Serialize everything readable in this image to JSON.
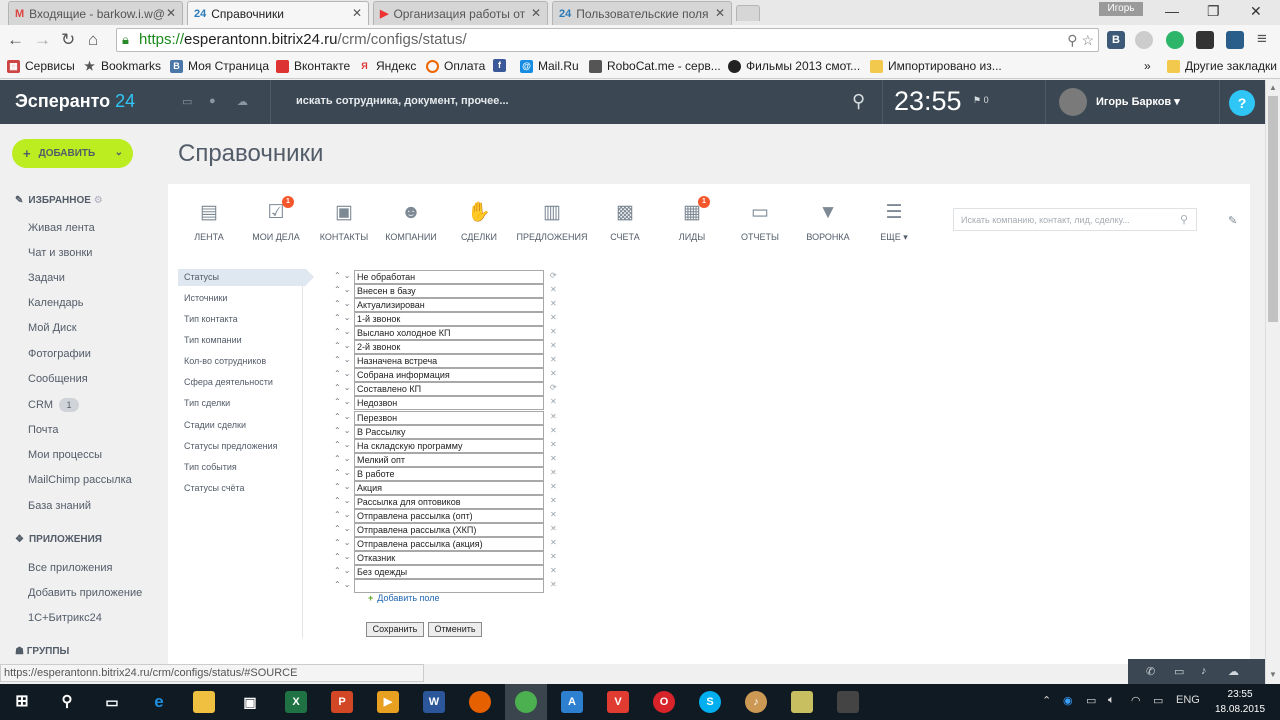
{
  "browser": {
    "tabs": [
      {
        "title": "Входящие - barkow.i.w@",
        "icon": "gmail-icon"
      },
      {
        "title": "Справочники",
        "icon": "bitrix24-icon"
      },
      {
        "title": "Организация работы от",
        "icon": "youtube-icon"
      },
      {
        "title": "Пользовательские поля",
        "icon": "bitrix24-icon"
      }
    ],
    "window_user": "Игорь",
    "url_protocol": "https://",
    "url_host": "esperantonn.bitrix24.ru",
    "url_path": "/crm/configs/status/",
    "bookmarks": [
      "Сервисы",
      "Bookmarks",
      "Моя Страница",
      "Вконтакте",
      "Яндекс",
      "Оплата",
      "Mail.Ru",
      "RoboCat.me - серв...",
      "Фильмы 2013 смот...",
      "Импортировано из..."
    ],
    "bookmarks_more": "»",
    "other_bookmarks": "Другие закладки"
  },
  "header": {
    "logo_main": "Эсперанто",
    "logo_num": "24",
    "search_placeholder": "искать сотрудника, документ, прочее...",
    "time": "23:55",
    "flag_count": "0",
    "user_name": "Игорь Барков",
    "help": "?"
  },
  "sidebar": {
    "add_button": "ДОБАВИТЬ",
    "favorites_title": "ИЗБРАННОЕ",
    "favorites": [
      "Живая лента",
      "Чат и звонки",
      "Задачи",
      "Календарь",
      "Мой Диск",
      "Фотографии",
      "Сообщения",
      "CRM",
      "Почта",
      "Мои процессы",
      "MailChimp рассылка",
      "База знаний"
    ],
    "crm_badge": "1",
    "apps_title": "ПРИЛОЖЕНИЯ",
    "apps": [
      "Все приложения",
      "Добавить приложение",
      "1С+Битрикс24"
    ],
    "groups_title": "ГРУППЫ"
  },
  "page": {
    "title": "Справочники",
    "toolbar": [
      {
        "label": "ЛЕНТА",
        "icon": "feed-icon"
      },
      {
        "label": "МОИ ДЕЛА",
        "icon": "tasks-icon",
        "count": "1"
      },
      {
        "label": "КОНТАКТЫ",
        "icon": "contacts-icon"
      },
      {
        "label": "КОМПАНИИ",
        "icon": "companies-icon"
      },
      {
        "label": "СДЕЛКИ",
        "icon": "deals-icon"
      },
      {
        "label": "ПРЕДЛОЖЕНИЯ",
        "icon": "quotes-icon"
      },
      {
        "label": "СЧЕТА",
        "icon": "invoices-icon"
      },
      {
        "label": "ЛИДЫ",
        "icon": "leads-icon",
        "count": "1"
      },
      {
        "label": "ОТЧЕТЫ",
        "icon": "reports-icon"
      },
      {
        "label": "ВОРОНКА",
        "icon": "funnel-icon"
      },
      {
        "label": "ЕЩЕ",
        "icon": "more-icon"
      }
    ],
    "search_placeholder": "Искать компанию, контакт, лид, сделку...",
    "subnav": [
      "Статусы",
      "Источники",
      "Тип контакта",
      "Тип компании",
      "Кол-во сотрудников",
      "Сфера деятельности",
      "Тип сделки",
      "Стадии сделки",
      "Статусы предложения",
      "Тип события",
      "Статусы счёта"
    ],
    "statuses": [
      "Не обработан",
      "Внесен в базу",
      "Актуализирован",
      "1-й звонок",
      "Выслано холодное КП",
      "2-й звонок",
      "Назначена встреча",
      "Собрана информация",
      "Составлено КП",
      "Недозвон",
      "Перезвон",
      "В Рассылку",
      "На складскую программу",
      "Мелкий опт",
      "В работе",
      "Акция",
      "Рассылка для оптовиков",
      "Отправлена рассылка (опт)",
      "Отправлена рассылка (ХКП)",
      "Отправлена рассылка (акция)",
      "Отказник",
      "Без одежды",
      ""
    ],
    "add_field": "Добавить поле",
    "save": "Сохранить",
    "cancel": "Отменить"
  },
  "status_url": "https://esperantonn.bitrix24.ru/crm/configs/status/#SOURCE",
  "taskbar": {
    "lang": "ENG",
    "time": "23:55",
    "date": "18.08.2015"
  }
}
